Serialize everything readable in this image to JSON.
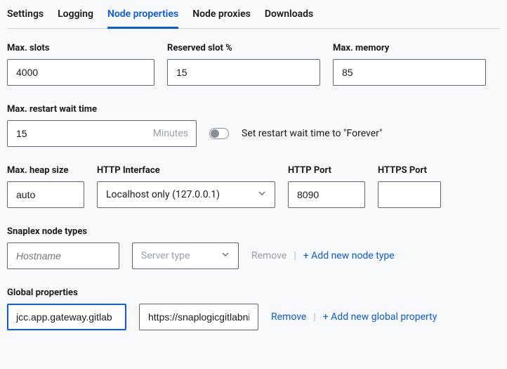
{
  "tabs": [
    {
      "label": "Settings"
    },
    {
      "label": "Logging"
    },
    {
      "label": "Node properties"
    },
    {
      "label": "Node proxies"
    },
    {
      "label": "Downloads"
    }
  ],
  "activeTabIndex": 2,
  "fields": {
    "maxSlots": {
      "label": "Max. slots",
      "value": "4000"
    },
    "reservedSlotPct": {
      "label": "Reserved slot %",
      "value": "15"
    },
    "maxMemory": {
      "label": "Max. memory",
      "value": "85"
    },
    "maxRestartWait": {
      "label": "Max. restart wait time",
      "value": "15",
      "unit": "Minutes"
    },
    "restartForeverToggle": {
      "label": "Set restart wait time to \"Forever\"",
      "value": false
    },
    "maxHeapSize": {
      "label": "Max. heap size",
      "value": "auto"
    },
    "httpInterface": {
      "label": "HTTP Interface",
      "selected": "Localhost only (127.0.0.1)"
    },
    "httpPort": {
      "label": "HTTP Port",
      "value": "8090"
    },
    "httpsPort": {
      "label": "HTTPS Port",
      "value": ""
    }
  },
  "nodeTypes": {
    "label": "Snaplex node types",
    "rows": [
      {
        "hostname": "",
        "hostnamePlaceholder": "Hostname",
        "serverTypePlaceholder": "Server type"
      }
    ],
    "addLabel": "+ Add new node type",
    "removeLabel": "Remove"
  },
  "globalProps": {
    "label": "Global properties",
    "rows": [
      {
        "key": "jcc.app.gateway.gitlab",
        "value": "https://snaplogicgitlabni"
      }
    ],
    "addLabel": "+ Add new global property",
    "removeLabel": "Remove"
  }
}
